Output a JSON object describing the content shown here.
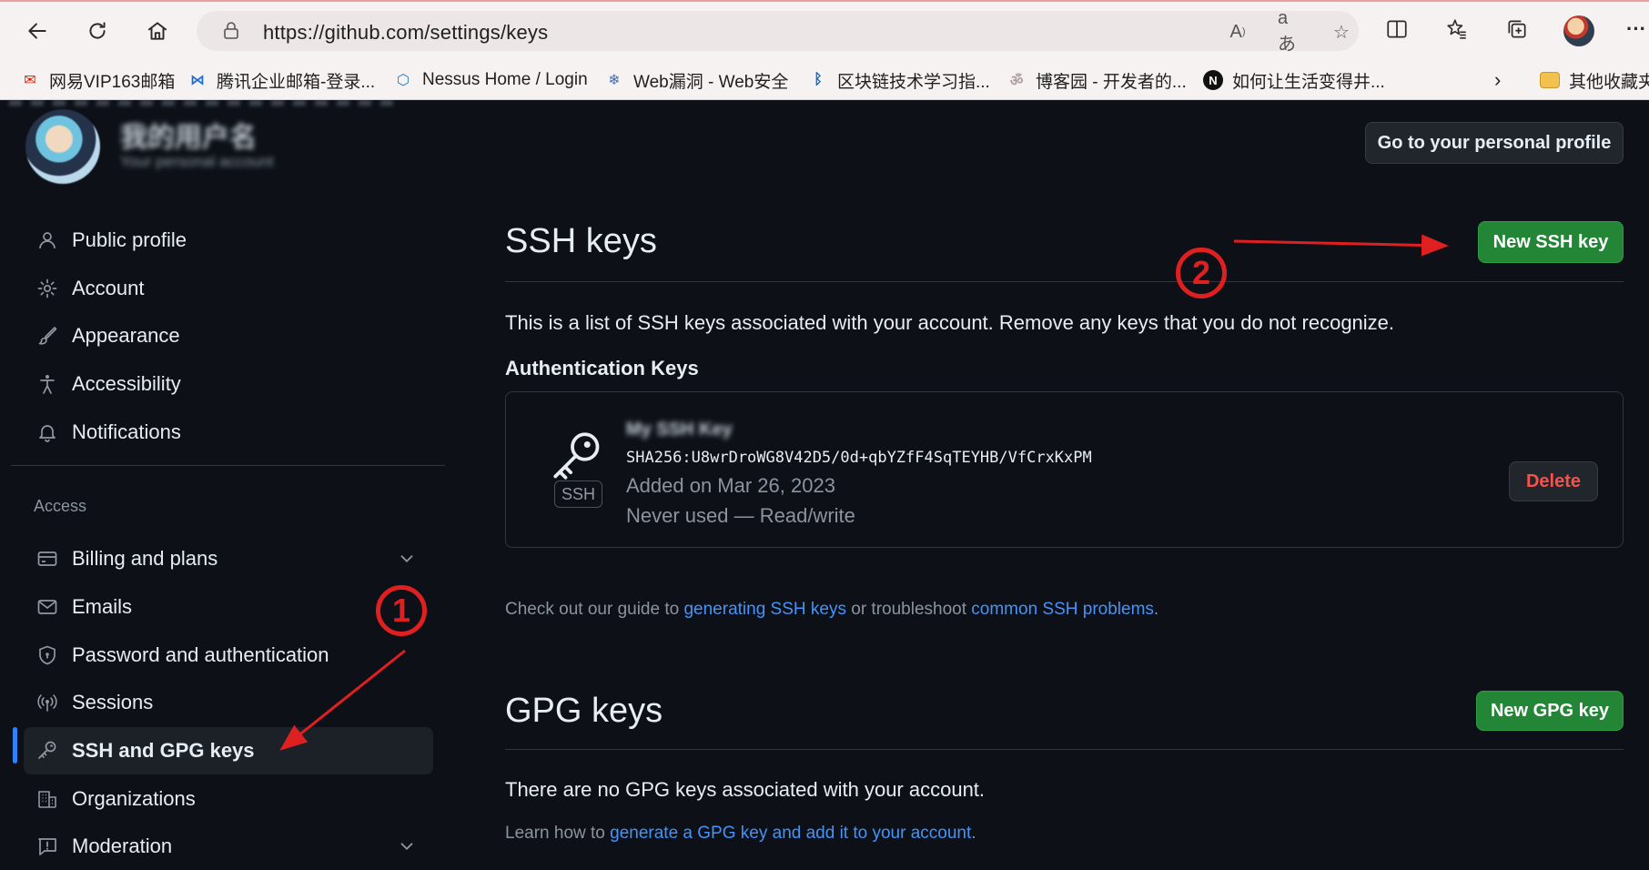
{
  "browser": {
    "url": "https://github.com/settings/keys",
    "bookmarks": [
      {
        "label": "网易VIP163邮箱",
        "icon": "netease-mail-icon"
      },
      {
        "label": "腾讯企业邮箱-登录...",
        "icon": "tencent-mail-icon"
      },
      {
        "label": "Nessus Home / Login",
        "icon": "nessus-icon"
      },
      {
        "label": "Web漏洞 - Web安全",
        "icon": "snowflake-icon"
      },
      {
        "label": "区块链技术学习指...",
        "icon": "bluetooth-icon"
      },
      {
        "label": "博客园 - 开发者的...",
        "icon": "cnblogs-icon"
      },
      {
        "label": "如何让生活变得井...",
        "icon": "notion-icon"
      },
      {
        "label": "其他收藏夹",
        "icon": "folder-icon"
      }
    ],
    "colors": {
      "chrome_bg": "#f7f2f2",
      "address_bg": "#ece6e6"
    }
  },
  "header": {
    "username": "我的用户名",
    "subtitle": "Your personal account",
    "profile_button": "Go to your personal profile"
  },
  "sidebar": {
    "items": [
      {
        "label": "Public profile",
        "icon": "person-icon"
      },
      {
        "label": "Account",
        "icon": "gear-icon"
      },
      {
        "label": "Appearance",
        "icon": "paintbrush-icon"
      },
      {
        "label": "Accessibility",
        "icon": "accessibility-icon"
      },
      {
        "label": "Notifications",
        "icon": "bell-icon"
      }
    ],
    "access_heading": "Access",
    "access_items": [
      {
        "label": "Billing and plans",
        "icon": "credit-card-icon",
        "expandable": true
      },
      {
        "label": "Emails",
        "icon": "mail-icon"
      },
      {
        "label": "Password and authentication",
        "icon": "shield-lock-icon"
      },
      {
        "label": "Sessions",
        "icon": "broadcast-icon"
      },
      {
        "label": "SSH and GPG keys",
        "icon": "key-icon",
        "active": true
      },
      {
        "label": "Organizations",
        "icon": "organization-icon"
      },
      {
        "label": "Moderation",
        "icon": "report-icon",
        "expandable": true
      }
    ]
  },
  "ssh": {
    "title": "SSH keys",
    "new_button": "New SSH key",
    "description": "This is a list of SSH keys associated with your account. Remove any keys that you do not recognize.",
    "auth_heading": "Authentication Keys",
    "key": {
      "name": "My SSH Key",
      "badge": "SSH",
      "fingerprint": "SHA256:U8wrDroWG8V42D5/0d+qbYZfF4SqTEYHB/VfCrxKxPM",
      "added": "Added on Mar 26, 2023",
      "usage": "Never used — Read/write",
      "delete_button": "Delete"
    },
    "guide_prefix": "Check out our guide to ",
    "guide_link1": "generating SSH keys",
    "guide_middle": " or troubleshoot ",
    "guide_link2": "common SSH problems",
    "guide_suffix": "."
  },
  "gpg": {
    "title": "GPG keys",
    "new_button": "New GPG key",
    "empty_text": "There are no GPG keys associated with your account.",
    "learn_prefix": "Learn how to ",
    "learn_link": "generate a GPG key and add it to your account",
    "learn_suffix": "."
  },
  "annotations": {
    "step1": "1",
    "step2": "2",
    "color": "#e02020"
  },
  "theme": {
    "bg": "#0d1117",
    "border": "#30363d",
    "link": "#4493f8",
    "green": "#238636",
    "danger": "#f85149",
    "accent": "#2f81f7"
  }
}
